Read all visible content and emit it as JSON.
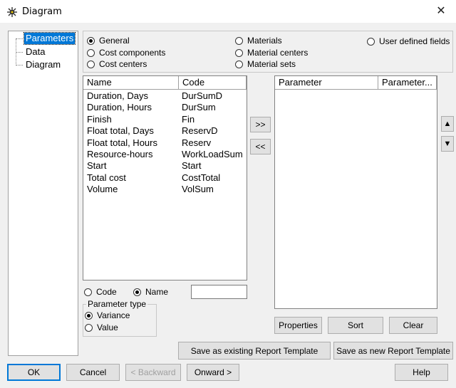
{
  "window": {
    "title": "Diagram",
    "close_glyph": "✕"
  },
  "tree": {
    "items": [
      {
        "label": "Parameters",
        "selected": true
      },
      {
        "label": "Data",
        "selected": false
      },
      {
        "label": "Diagram",
        "selected": false
      }
    ]
  },
  "categories": {
    "general": {
      "label": "General",
      "checked": true
    },
    "cost_components": {
      "label": "Cost components",
      "checked": false
    },
    "cost_centers": {
      "label": "Cost centers",
      "checked": false
    },
    "materials": {
      "label": "Materials",
      "checked": false
    },
    "material_centers": {
      "label": "Material centers",
      "checked": false
    },
    "material_sets": {
      "label": "Material sets",
      "checked": false
    },
    "user_defined": {
      "label": "User defined fields",
      "checked": false
    }
  },
  "available": {
    "headers": {
      "name": "Name",
      "code": "Code"
    },
    "rows": [
      {
        "name": "Duration, Days",
        "code": "DurSumD"
      },
      {
        "name": "Duration, Hours",
        "code": "DurSum"
      },
      {
        "name": "Finish",
        "code": "Fin"
      },
      {
        "name": "Float total, Days",
        "code": "ReservD"
      },
      {
        "name": "Float total, Hours",
        "code": "Reserv"
      },
      {
        "name": "Resource-hours",
        "code": "WorkLoadSum"
      },
      {
        "name": "Start",
        "code": "Start"
      },
      {
        "name": "Total cost",
        "code": "CostTotal"
      },
      {
        "name": "Volume",
        "code": "VolSum"
      }
    ]
  },
  "selected": {
    "headers": {
      "parameter": "Parameter",
      "parameter2": "Parameter..."
    }
  },
  "transfer": {
    "add": ">>",
    "remove": "<<"
  },
  "move": {
    "up": "▲",
    "down": "▼"
  },
  "search_by": {
    "code": {
      "label": "Code",
      "checked": false
    },
    "name": {
      "label": "Name",
      "checked": true
    },
    "value": ""
  },
  "parameter_type": {
    "legend": "Parameter type",
    "variance": {
      "label": "Variance",
      "checked": true
    },
    "value": {
      "label": "Value",
      "checked": false
    }
  },
  "actions": {
    "properties": "Properties",
    "sort": "Sort",
    "clear": "Clear",
    "save_existing": "Save as existing Report Template",
    "save_new": "Save as new Report Template"
  },
  "footer": {
    "ok": "OK",
    "cancel": "Cancel",
    "backward": "< Backward",
    "onward": "Onward >",
    "help": "Help"
  }
}
